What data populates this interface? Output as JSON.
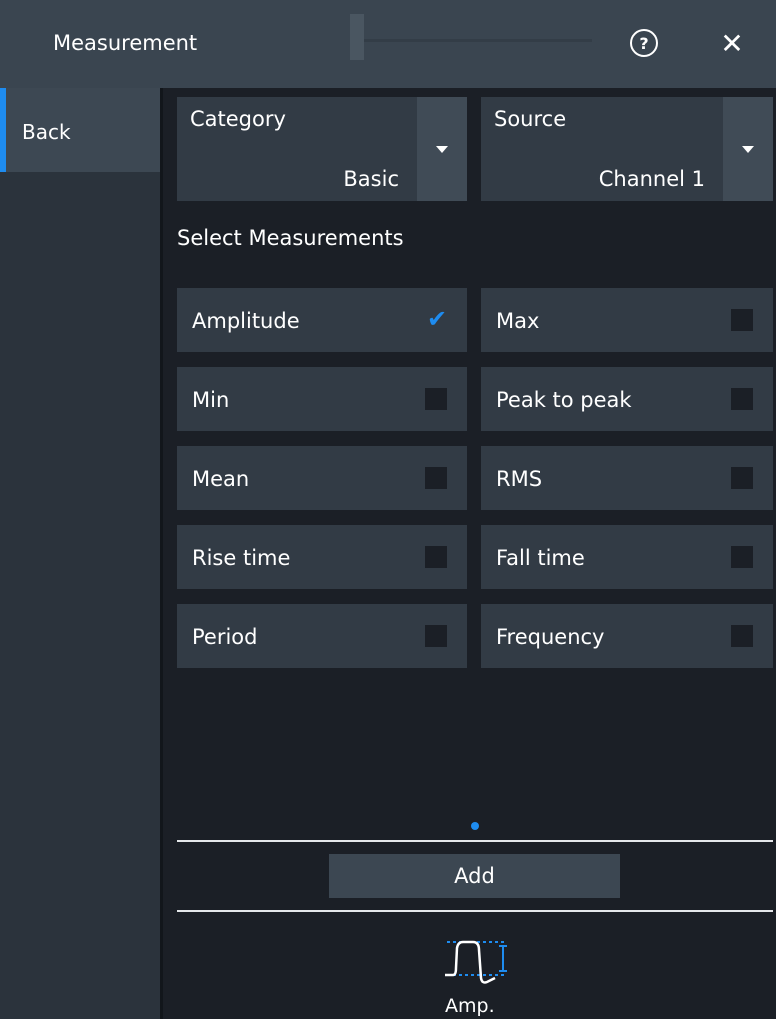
{
  "window": {
    "title": "Measurement"
  },
  "icons": {
    "help": "help-icon",
    "close": "close-icon",
    "dropdown": "chevron-down-icon",
    "check": "check-icon",
    "amplitude": "amplitude-waveform-icon"
  },
  "colors": {
    "accent": "#1e8cf0",
    "titlebar": "#3a4550",
    "panel": "#1b1f26",
    "tile": "#323b45"
  },
  "header": {
    "help_glyph": "?",
    "close_glyph": "✕"
  },
  "sidebar": {
    "items": [
      {
        "label": "Back",
        "selected": true
      }
    ]
  },
  "category": {
    "label": "Category",
    "value": "Basic"
  },
  "source": {
    "label": "Source",
    "value": "Channel 1"
  },
  "measurements": {
    "title": "Select Measurements",
    "items": [
      {
        "label": "Amplitude",
        "checked": true
      },
      {
        "label": "Max",
        "checked": false
      },
      {
        "label": "Min",
        "checked": false
      },
      {
        "label": "Peak to peak",
        "checked": false
      },
      {
        "label": "Mean",
        "checked": false
      },
      {
        "label": "RMS",
        "checked": false
      },
      {
        "label": "Rise time",
        "checked": false
      },
      {
        "label": "Fall time",
        "checked": false
      },
      {
        "label": "Period",
        "checked": false
      },
      {
        "label": "Frequency",
        "checked": false
      }
    ]
  },
  "pagination": {
    "page": 1
  },
  "actions": {
    "add_label": "Add"
  },
  "selected_measurement": {
    "label": "Amp."
  }
}
